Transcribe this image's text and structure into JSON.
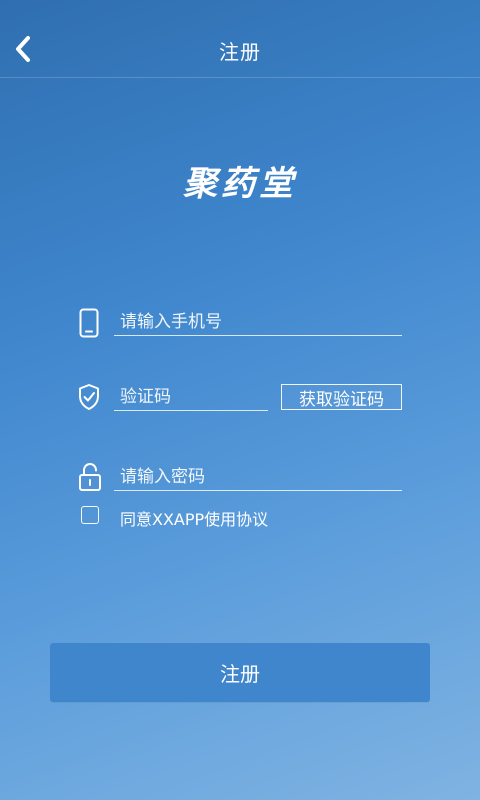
{
  "header": {
    "title": "注册",
    "back_icon": "chevron-left-icon"
  },
  "logo": {
    "text": "聚药堂"
  },
  "form": {
    "phone": {
      "placeholder": "请输入手机号",
      "value": "",
      "icon": "phone-icon"
    },
    "code": {
      "placeholder": "验证码",
      "value": "",
      "icon": "shield-check-icon",
      "button_label": "获取验证码"
    },
    "password": {
      "placeholder": "请输入密码",
      "value": "",
      "icon": "unlock-icon"
    }
  },
  "agreement": {
    "label": "同意XXAPP使用协议",
    "checked": false
  },
  "submit": {
    "label": "注册"
  },
  "colors": {
    "background_start": "#2f6fb0",
    "background_end": "#7fb3e2",
    "button_bg": "#3f86cd",
    "text": "#ffffff"
  }
}
